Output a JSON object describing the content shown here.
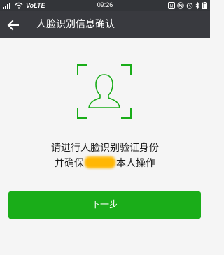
{
  "status_bar": {
    "carrier": "VoLTE",
    "time": "09:26",
    "icons": [
      "signal-icon",
      "wifi-icon",
      "data-icon",
      "nfc-icon",
      "alarm-icon",
      "bluetooth-icon",
      "battery-icon"
    ]
  },
  "title_bar": {
    "title": "人脸识别信息确认",
    "back_icon": "back-arrow-icon"
  },
  "main": {
    "face_icon": "face-frame-icon",
    "instruction_line1": "请进行人脸识别验证身份",
    "instruction_line2_prefix": "并确保",
    "instruction_line2_suffix": "本人操作",
    "next_button_label": "下一步"
  },
  "colors": {
    "status_bar": "#333539",
    "title_bar": "#393a3f",
    "accent_green": "#1aad19",
    "background": "#f5f5f5",
    "redaction": "#ffb703"
  }
}
